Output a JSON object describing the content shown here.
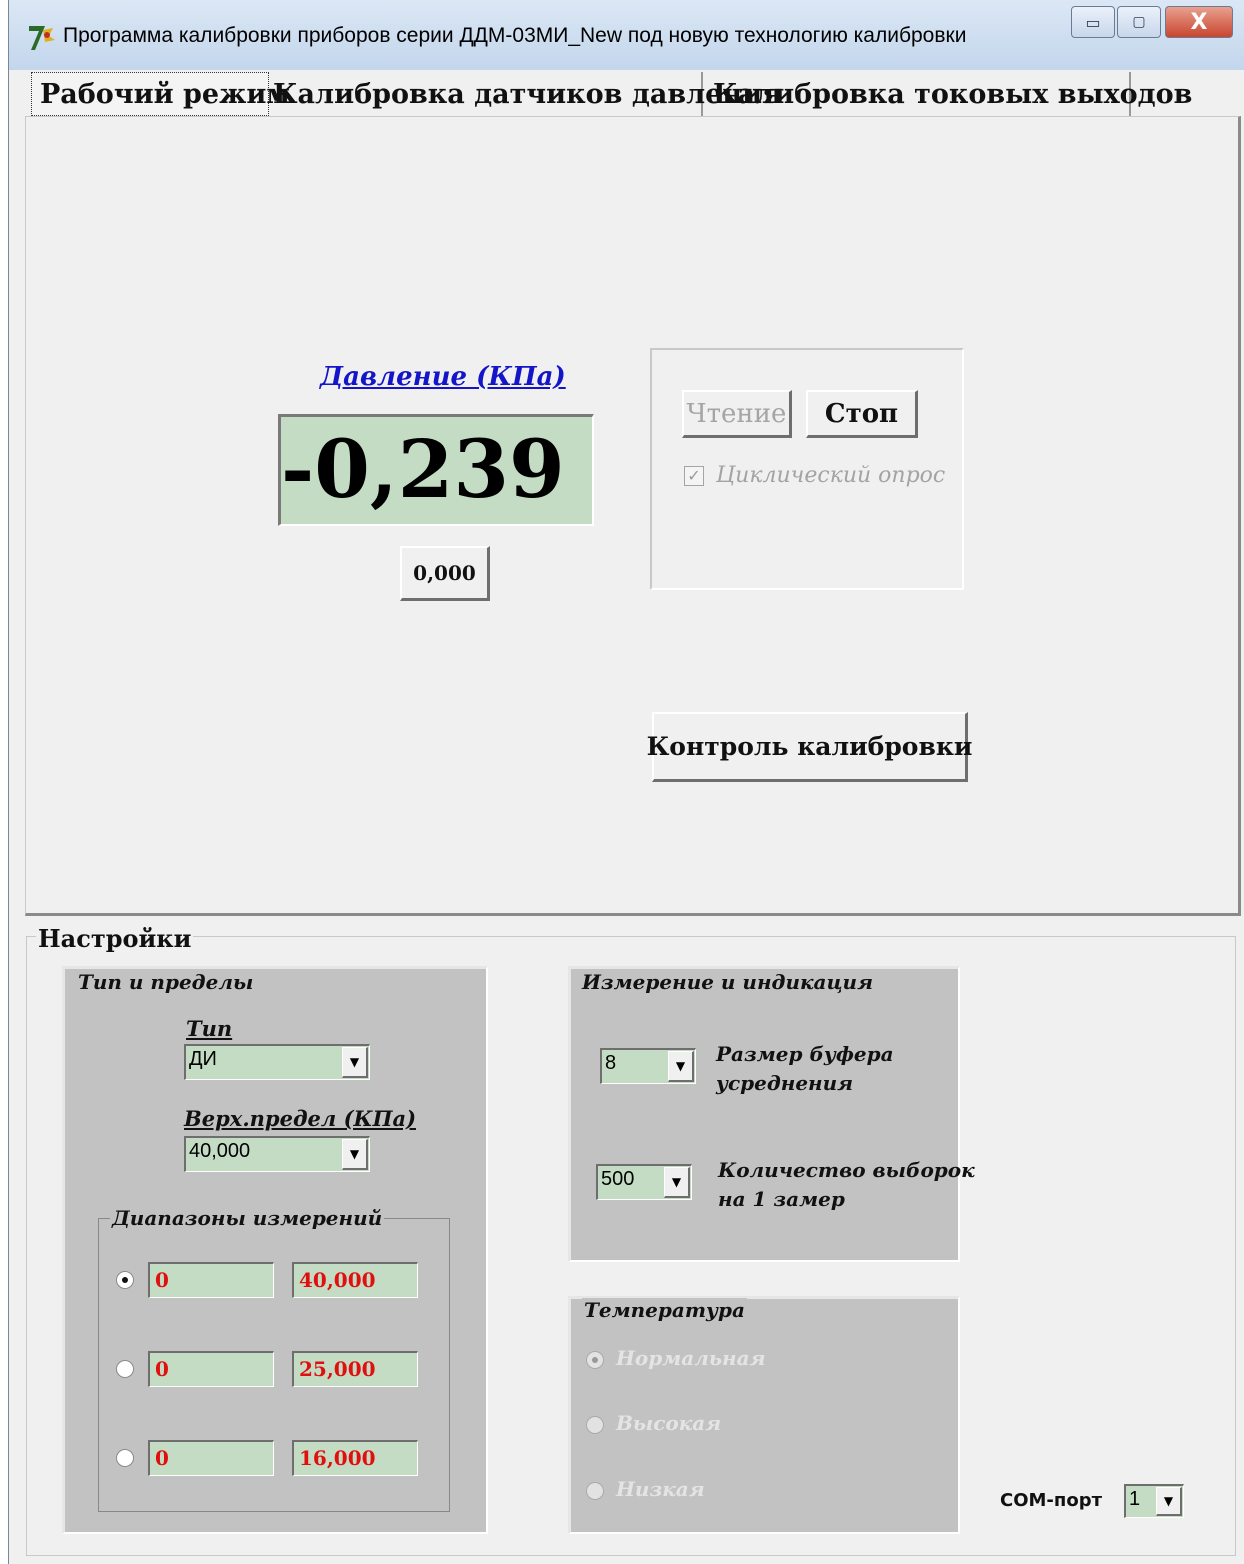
{
  "window": {
    "title": "Программа калибровки приборов серии ДДМ-03МИ_New под новую технологию калибровки",
    "minimize_glyph": "▭",
    "maximize_glyph": "▢",
    "close_glyph": "X"
  },
  "tabs": [
    {
      "label": "Рабочий режим",
      "active": true
    },
    {
      "label": "Калибровка датчиков давления",
      "active": false
    },
    {
      "label": "Калибровка токовых выходов",
      "active": false
    }
  ],
  "work": {
    "pressure_label": "Давление (КПа)",
    "pressure_value": "-0,239",
    "zero_button": "0,000",
    "read_button": "Чтение",
    "stop_button": "Стоп",
    "cyclic_checkbox_label": "Циклический опрос",
    "cyclic_checked": true,
    "control_button": "Контроль калибровки"
  },
  "settings": {
    "title": "Настройки",
    "type_limits": {
      "group_title": "Тип и пределы",
      "type_label": "Тип",
      "type_value": "ДИ",
      "upper_label": "Верх.предел (КПа)",
      "upper_value": "40,000",
      "ranges_title": "Диапазоны измерений",
      "ranges": [
        {
          "from": "0",
          "to": "40,000",
          "selected": true
        },
        {
          "from": "0",
          "to": "25,000",
          "selected": false
        },
        {
          "from": "0",
          "to": "16,000",
          "selected": false
        }
      ]
    },
    "measure": {
      "group_title": "Измерение и индикация",
      "buffer_value": "8",
      "buffer_label_1": "Размер буфера",
      "buffer_label_2": "усреднения",
      "samples_value": "500",
      "samples_label_1": "Количество выборок",
      "samples_label_2": "на 1 замер"
    },
    "temperature": {
      "group_title": "Температура",
      "options": [
        {
          "label": "Нормальная",
          "selected": true
        },
        {
          "label": "Высокая",
          "selected": false
        },
        {
          "label": "Низкая",
          "selected": false
        }
      ]
    },
    "com_port": {
      "label": "COM-порт",
      "value": "1"
    }
  },
  "colors": {
    "display_bg": "#c4dcc4",
    "range_text": "#e01010",
    "link_blue": "#1414c8",
    "group_bg": "#c2c2c2"
  }
}
